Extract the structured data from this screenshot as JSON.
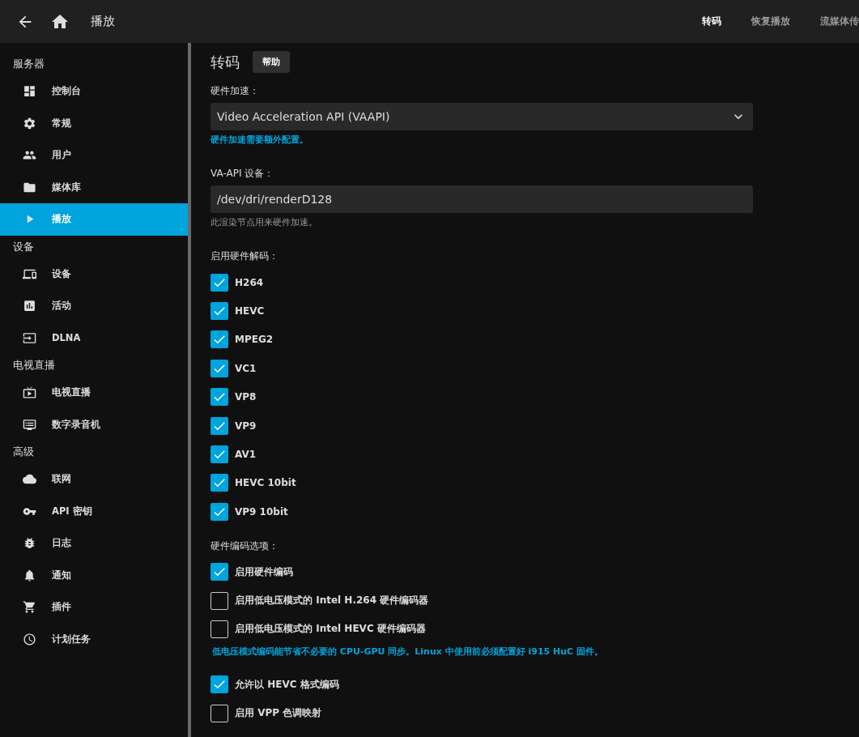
{
  "header": {
    "title": "播放",
    "tabs": [
      {
        "label": "转码",
        "selected": true
      },
      {
        "label": "恢复播放",
        "selected": false
      },
      {
        "label": "流媒体传",
        "selected": false
      }
    ]
  },
  "sidebar": {
    "sections": [
      {
        "title": "服务器",
        "items": [
          {
            "label": "控制台",
            "selected": false
          },
          {
            "label": "常规",
            "selected": false
          },
          {
            "label": "用户",
            "selected": false
          },
          {
            "label": "媒体库",
            "selected": false
          },
          {
            "label": "播放",
            "selected": true
          }
        ]
      },
      {
        "title": "设备",
        "items": [
          {
            "label": "设备",
            "selected": false
          },
          {
            "label": "活动",
            "selected": false
          },
          {
            "label": "DLNA",
            "selected": false
          }
        ]
      },
      {
        "title": "电视直播",
        "items": [
          {
            "label": "电视直播",
            "selected": false
          },
          {
            "label": "数字录音机",
            "selected": false
          }
        ]
      },
      {
        "title": "高级",
        "items": [
          {
            "label": "联网",
            "selected": false
          },
          {
            "label": "API 密钥",
            "selected": false
          },
          {
            "label": "日志",
            "selected": false
          },
          {
            "label": "通知",
            "selected": false
          },
          {
            "label": "插件",
            "selected": false
          },
          {
            "label": "计划任务",
            "selected": false
          }
        ]
      }
    ]
  },
  "main": {
    "title": "转码",
    "help_button": "帮助",
    "hardware_acceleration": {
      "label": "硬件加速：",
      "value": "Video Acceleration API (VAAPI)",
      "note": "硬件加速需要额外配置。"
    },
    "vaapi_device": {
      "label": "VA-API 设备：",
      "value": "/dev/dri/renderD128",
      "note": "此渲染节点用来硬件加速。"
    },
    "decoding": {
      "label": "启用硬件解码：",
      "options": [
        {
          "label": "H264",
          "checked": true
        },
        {
          "label": "HEVC",
          "checked": true
        },
        {
          "label": "MPEG2",
          "checked": true
        },
        {
          "label": "VC1",
          "checked": true
        },
        {
          "label": "VP8",
          "checked": true
        },
        {
          "label": "VP9",
          "checked": true
        },
        {
          "label": "AV1",
          "checked": true
        },
        {
          "label": "HEVC 10bit",
          "checked": true
        },
        {
          "label": "VP9 10bit",
          "checked": true
        }
      ]
    },
    "encoding": {
      "label": "硬件编码选项：",
      "items": [
        {
          "kind": "checkbox",
          "label": "启用硬件编码",
          "checked": true
        },
        {
          "kind": "checkbox",
          "label": "启用低电压模式的 Intel H.264 硬件编码器",
          "checked": false
        },
        {
          "kind": "checkbox",
          "label": "启用低电压模式的 Intel HEVC 硬件编码器",
          "checked": false
        },
        {
          "kind": "note",
          "label": "低电压模式编码能节省不必要的 CPU-GPU 同步。Linux 中使用前必须配置好 i915 HuC 固件。"
        },
        {
          "kind": "checkbox",
          "label": "允许以 HEVC 格式编码",
          "checked": true
        },
        {
          "kind": "checkbox",
          "label": "启用 VPP 色调映射",
          "checked": false
        }
      ]
    }
  }
}
